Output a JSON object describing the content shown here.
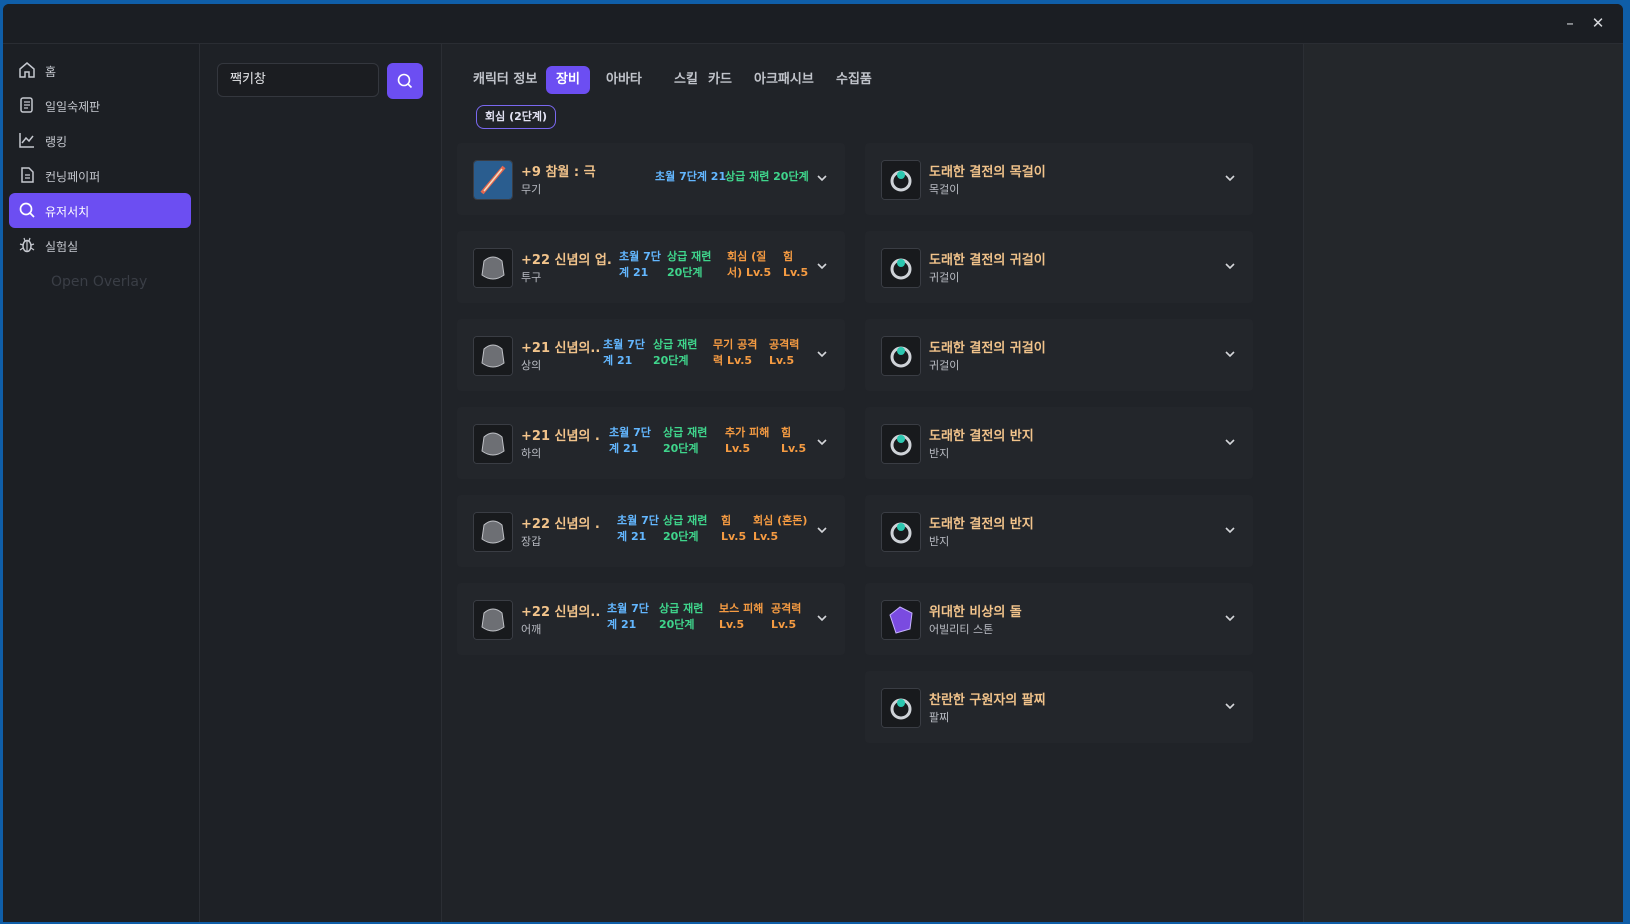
{
  "window": {
    "minimize_label": "–",
    "close_label": "✕"
  },
  "sidebar": {
    "items": [
      {
        "label": "홈",
        "icon": "home-icon"
      },
      {
        "label": "일일숙제판",
        "icon": "scroll-icon"
      },
      {
        "label": "랭킹",
        "icon": "chart-icon"
      },
      {
        "label": "컨닝페이퍼",
        "icon": "document-icon"
      },
      {
        "label": "유저서치",
        "icon": "search-icon",
        "active": true
      },
      {
        "label": "실험실",
        "icon": "bug-icon"
      }
    ],
    "overlay_link": "Open Overlay"
  },
  "search": {
    "value": "짹키창"
  },
  "tabs": [
    "캐릭터 정보",
    "장비",
    "아바타",
    "스킬",
    "카드",
    "아크패시브",
    "수집품"
  ],
  "active_tab": "장비",
  "badge": "회심 (2단계)",
  "equipment_left": [
    {
      "name": "+9 참월 : 극",
      "type": "무기",
      "stats": [
        {
          "l1": "초월 7단계 21",
          "l2": "",
          "c": "blue"
        },
        {
          "l1": "상급 재련 20단계",
          "l2": "",
          "c": "green"
        }
      ]
    },
    {
      "name": "+22 신념의 업...",
      "type": "투구",
      "stats": [
        {
          "l1": "초월 7단",
          "l2": "계 21",
          "c": "blue"
        },
        {
          "l1": "상급 재련",
          "l2": "20단계",
          "c": "green"
        },
        {
          "l1": "회심 (질",
          "l2": "서) Lv.5",
          "c": "orange"
        },
        {
          "l1": "힘",
          "l2": "Lv.5",
          "c": "orange"
        }
      ]
    },
    {
      "name": "+21 신념의...",
      "type": "상의",
      "stats": [
        {
          "l1": "초월 7단",
          "l2": "계 21",
          "c": "blue"
        },
        {
          "l1": "상급 재련",
          "l2": "20단계",
          "c": "green"
        },
        {
          "l1": "무기 공격",
          "l2": "력 Lv.5",
          "c": "orange"
        },
        {
          "l1": "공격력",
          "l2": "Lv.5",
          "c": "orange"
        }
      ]
    },
    {
      "name": "+21 신념의 ...",
      "type": "하의",
      "stats": [
        {
          "l1": "초월 7단",
          "l2": "계 21",
          "c": "blue"
        },
        {
          "l1": "상급 재련",
          "l2": "20단계",
          "c": "green"
        },
        {
          "l1": "추가 피해",
          "l2": "Lv.5",
          "c": "orange"
        },
        {
          "l1": "힘",
          "l2": "Lv.5",
          "c": "orange"
        }
      ]
    },
    {
      "name": "+22 신념의 ...",
      "type": "장갑",
      "stats": [
        {
          "l1": "초월 7단",
          "l2": "계 21",
          "c": "blue"
        },
        {
          "l1": "상급 재련",
          "l2": "20단계",
          "c": "green"
        },
        {
          "l1": "힘",
          "l2": "Lv.5",
          "c": "orange"
        },
        {
          "l1": "회심 (혼돈)",
          "l2": "Lv.5",
          "c": "orange"
        }
      ]
    },
    {
      "name": "+22 신념의...",
      "type": "어깨",
      "stats": [
        {
          "l1": "초월 7단",
          "l2": "계 21",
          "c": "blue"
        },
        {
          "l1": "상급 재련",
          "l2": "20단계",
          "c": "green"
        },
        {
          "l1": "보스 피해",
          "l2": "Lv.5",
          "c": "orange"
        },
        {
          "l1": "공격력",
          "l2": "Lv.5",
          "c": "orange"
        }
      ]
    }
  ],
  "equipment_right": [
    {
      "name": "도래한 결전의 목걸이",
      "type": "목걸이"
    },
    {
      "name": "도래한 결전의 귀걸이",
      "type": "귀걸이"
    },
    {
      "name": "도래한 결전의 귀걸이",
      "type": "귀걸이"
    },
    {
      "name": "도래한 결전의 반지",
      "type": "반지"
    },
    {
      "name": "도래한 결전의 반지",
      "type": "반지"
    },
    {
      "name": "위대한 비상의 돌",
      "type": "어빌리티 스톤"
    },
    {
      "name": "찬란한 구원자의 팔찌",
      "type": "팔찌"
    }
  ],
  "colors": {
    "accent": "#6c4ef2",
    "item_name": "#f1c38b",
    "stat_blue": "#63b7ff",
    "stat_green": "#3fd58c",
    "stat_orange": "#f59b42"
  }
}
